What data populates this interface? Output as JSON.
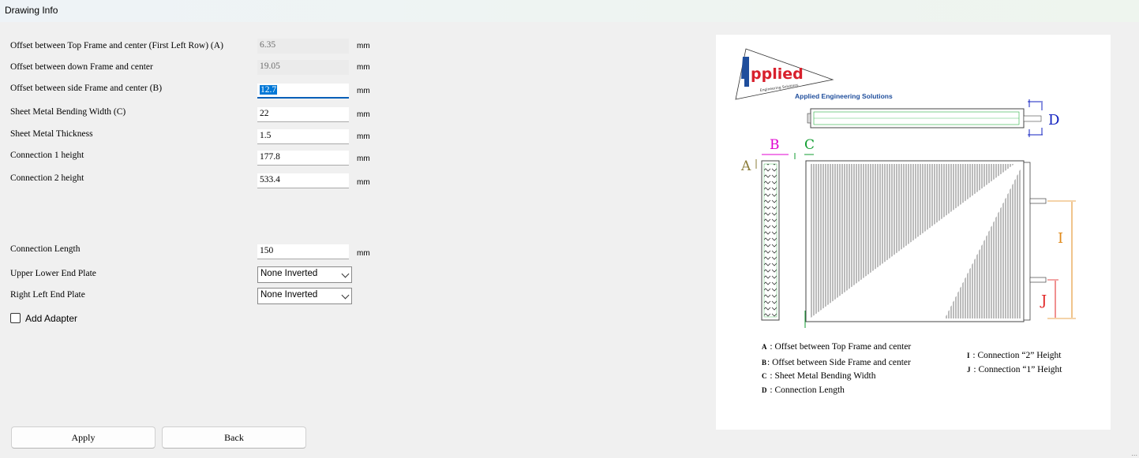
{
  "window": {
    "title": "Drawing Info"
  },
  "form": {
    "unit": "mm",
    "rows": [
      {
        "label": "Offset between Top Frame and center (First Left Row) (A)",
        "value": "6.35"
      },
      {
        "label": "Offset between down Frame and center",
        "value": "19.05"
      },
      {
        "label": "Offset between side Frame and center (B)",
        "value": "12.7"
      },
      {
        "label": "Sheet Metal Bending Width (C)",
        "value": "22"
      },
      {
        "label": "Sheet Metal Thickness",
        "value": "1.5"
      },
      {
        "label": "Connection 1 height",
        "value": "177.8"
      },
      {
        "label": "Connection 2 height",
        "value": "533.4"
      },
      {
        "label": "Connection Length",
        "value": "150"
      }
    ],
    "combos": [
      {
        "label": "Upper Lower End Plate",
        "value": "None Inverted"
      },
      {
        "label": "Right Left End Plate",
        "value": "None Inverted"
      }
    ],
    "adapter_checkbox": {
      "label": "Add Adapter",
      "checked": false
    }
  },
  "buttons": {
    "apply": "Apply",
    "back": "Back"
  },
  "drawing": {
    "logo_word": "pplied",
    "logo_tagline": "Engineering Solutions",
    "company": "Applied Engineering Solutions",
    "dim_labels": {
      "A": "A",
      "B": "B",
      "C": "C",
      "D": "D",
      "I": "I",
      "J": "J"
    },
    "legend_left": [
      {
        "key": "A",
        "text": ": Offset between Top Frame and center"
      },
      {
        "key": "B",
        "text": ": Offset between Side Frame and center"
      },
      {
        "key": "C",
        "text": ": Sheet Metal Bending Width"
      },
      {
        "key": "D",
        "text": ": Connection Length"
      }
    ],
    "legend_right": [
      {
        "key": "I",
        "text": ": Connection “2” Height"
      },
      {
        "key": "J",
        "text": ": Connection “1” Height"
      }
    ],
    "colors": {
      "A": "#8b7d3a",
      "B": "#e000d0",
      "C": "#109d30",
      "D": "#1020c0",
      "I": "#e08a1a",
      "J": "#e02020",
      "logo": "#d8202c"
    }
  },
  "corner_mark": "..."
}
